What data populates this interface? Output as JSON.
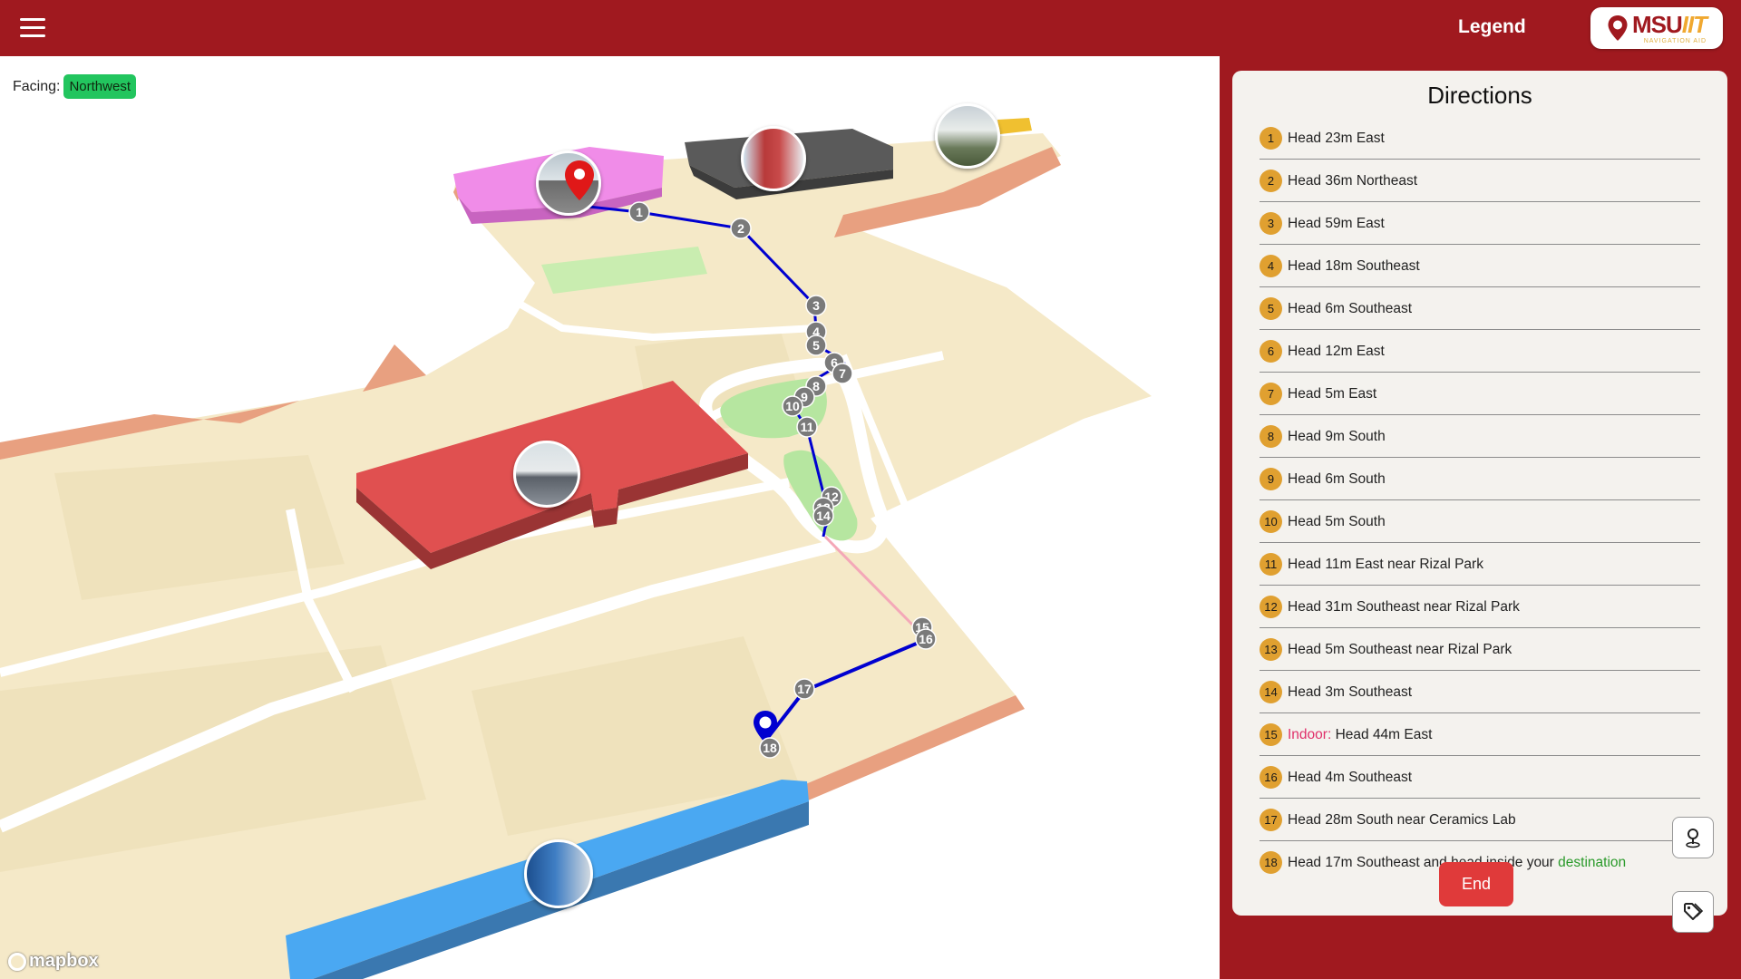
{
  "header": {
    "legend_label": "Legend",
    "logo": {
      "main_a": "MSU",
      "main_b": "IIT",
      "sub": "NAVIGATION AID"
    }
  },
  "map": {
    "facing_label": "Facing:",
    "facing_value": "Northwest",
    "attribution": "mapbox",
    "route_markers": [
      "1",
      "2",
      "3",
      "4",
      "5",
      "6",
      "7",
      "8",
      "9",
      "10",
      "11",
      "12",
      "13",
      "14",
      "15",
      "16",
      "17",
      "18"
    ]
  },
  "directions": {
    "title": "Directions",
    "steps": [
      {
        "n": "1",
        "text": "Head 23m East"
      },
      {
        "n": "2",
        "text": "Head 36m Northeast"
      },
      {
        "n": "3",
        "text": "Head 59m East"
      },
      {
        "n": "4",
        "text": "Head 18m Southeast"
      },
      {
        "n": "5",
        "text": "Head 6m Southeast"
      },
      {
        "n": "6",
        "text": "Head 12m East"
      },
      {
        "n": "7",
        "text": "Head 5m East"
      },
      {
        "n": "8",
        "text": "Head 9m South"
      },
      {
        "n": "9",
        "text": "Head 6m South"
      },
      {
        "n": "10",
        "text": "Head 5m South"
      },
      {
        "n": "11",
        "text": "Head 11m East near Rizal Park"
      },
      {
        "n": "12",
        "text": "Head 31m Southeast near Rizal Park"
      },
      {
        "n": "13",
        "text": "Head 5m Southeast near Rizal Park"
      },
      {
        "n": "14",
        "text": "Head 3m Southeast"
      },
      {
        "n": "15",
        "prefix": "Indoor:",
        "text": "Head 44m East"
      },
      {
        "n": "16",
        "text": "Head 4m Southeast"
      },
      {
        "n": "17",
        "text": "Head 28m South near Ceramics Lab"
      },
      {
        "n": "18",
        "text": "Head 17m Southeast and head inside your",
        "suffix": "destination"
      }
    ],
    "end_label": "End"
  },
  "colors": {
    "brand": "#a0191f",
    "route": "#0000d0",
    "step_badge": "#e0a030",
    "end_button": "#e03a3a",
    "facing_badge": "#22c55e"
  }
}
